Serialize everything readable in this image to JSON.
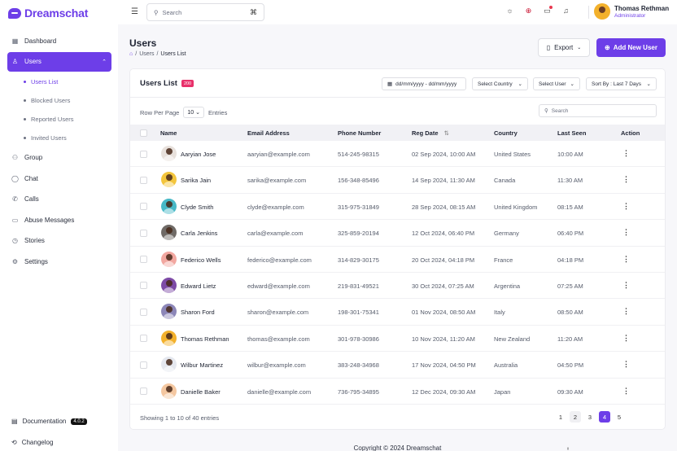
{
  "brand": {
    "name": "Dreamschat",
    "color": "#6d3ee8"
  },
  "sidebar": {
    "items": [
      {
        "label": "Dashboard",
        "icon": "grid-icon"
      },
      {
        "label": "Users",
        "icon": "user-icon",
        "active": true
      }
    ],
    "submenu": [
      {
        "label": "Users List",
        "active": true
      },
      {
        "label": "Blocked Users"
      },
      {
        "label": "Reported Users"
      },
      {
        "label": "Invited Users"
      }
    ],
    "items2": [
      {
        "label": "Group",
        "icon": "group-icon"
      },
      {
        "label": "Chat",
        "icon": "chat-icon"
      },
      {
        "label": "Calls",
        "icon": "phone-icon"
      },
      {
        "label": "Abuse Messages",
        "icon": "message-alert-icon"
      },
      {
        "label": "Stories",
        "icon": "stories-icon"
      },
      {
        "label": "Settings",
        "icon": "gear-icon"
      }
    ],
    "documentation": "Documentation",
    "version": "4.0.2",
    "changelog": "Changelog"
  },
  "header": {
    "search_placeholder": "Search",
    "search_shortcut": "⌘",
    "user_name": "Thomas Rethman",
    "user_role": "Administrator"
  },
  "page": {
    "title": "Users",
    "breadcrumb": [
      "Users",
      "Users List"
    ],
    "export_label": "Export",
    "add_label": "Add New User"
  },
  "card": {
    "title": "Users List",
    "count": "200",
    "date_filter": "dd/mm/yyyy - dd/mm/yyyy",
    "country_filter": "Select Country",
    "user_filter": "Select User",
    "sort": "Sort By : Last 7 Days",
    "rows_per_page_label": "Row Per Page",
    "rows_per_page_value": "10",
    "entries_label": "Entries",
    "search_placeholder": "Search"
  },
  "table": {
    "columns": [
      "Name",
      "Email Address",
      "Phone Number",
      "Reg Date",
      "Country",
      "Last Seen",
      "Action"
    ],
    "rows": [
      {
        "name": "Aaryian Jose",
        "email": "aaryian@example.com",
        "phone": "514-245-98315",
        "reg": "02 Sep 2024, 10:00 AM",
        "country": "United States",
        "seen": "10:00 AM",
        "color": "#e8e1dc"
      },
      {
        "name": "Sarika Jain",
        "email": "sarika@example.com",
        "phone": "156-348-85496",
        "reg": "14 Sep 2024, 11:30 AM",
        "country": "Canada",
        "seen": "11:30 AM",
        "color": "#f3c53c"
      },
      {
        "name": "Clyde Smith",
        "email": "clyde@example.com",
        "phone": "315-975-31849",
        "reg": "28 Sep 2024, 08:15 AM",
        "country": "United Kingdom",
        "seen": "08:15 AM",
        "color": "#47b9c7"
      },
      {
        "name": "Carla Jenkins",
        "email": "carla@example.com",
        "phone": "325-859-20194",
        "reg": "12 Oct 2024, 06:40 PM",
        "country": "Germany",
        "seen": "06:40 PM",
        "color": "#6f6a66"
      },
      {
        "name": "Federico Wells",
        "email": "federico@example.com",
        "phone": "314-829-30175",
        "reg": "20 Oct 2024, 04:18 PM",
        "country": "France",
        "seen": "04:18 PM",
        "color": "#f2a7a0"
      },
      {
        "name": "Edward Lietz",
        "email": "edward@example.com",
        "phone": "219-831-49521",
        "reg": "30 Oct 2024, 07:25 AM",
        "country": "Argentina",
        "seen": "07:25 AM",
        "color": "#7d4aa6"
      },
      {
        "name": "Sharon Ford",
        "email": "sharon@example.com",
        "phone": "198-301-75341",
        "reg": "01 Nov 2024, 08:50 AM",
        "country": "Italy",
        "seen": "08:50 AM",
        "color": "#8c86b8"
      },
      {
        "name": "Thomas Rethman",
        "email": "thomas@example.com",
        "phone": "301-978-30986",
        "reg": "10 Nov 2024, 11:20 AM",
        "country": "New Zealand",
        "seen": "11:20 AM",
        "color": "#f3b12c"
      },
      {
        "name": "Wilbur Martinez",
        "email": "wilbur@example.com",
        "phone": "383-248-34968",
        "reg": "17 Nov 2024, 04:50 PM",
        "country": "Australia",
        "seen": "04:50 PM",
        "color": "#e5e8ef"
      },
      {
        "name": "Danielle Baker",
        "email": "danielle@example.com",
        "phone": "736-795-34895",
        "reg": "12 Dec 2024, 09:30 AM",
        "country": "Japan",
        "seen": "09:30 AM",
        "color": "#f4c7a0"
      }
    ]
  },
  "footer": {
    "showing": "Showing 1 to 10 of 40 entries",
    "pages": [
      "1",
      "2",
      "3",
      "4",
      "5"
    ],
    "active_page": "4",
    "prev": "‹",
    "next": "›"
  },
  "copyright": "Copyright © 2024 Dreamschat"
}
